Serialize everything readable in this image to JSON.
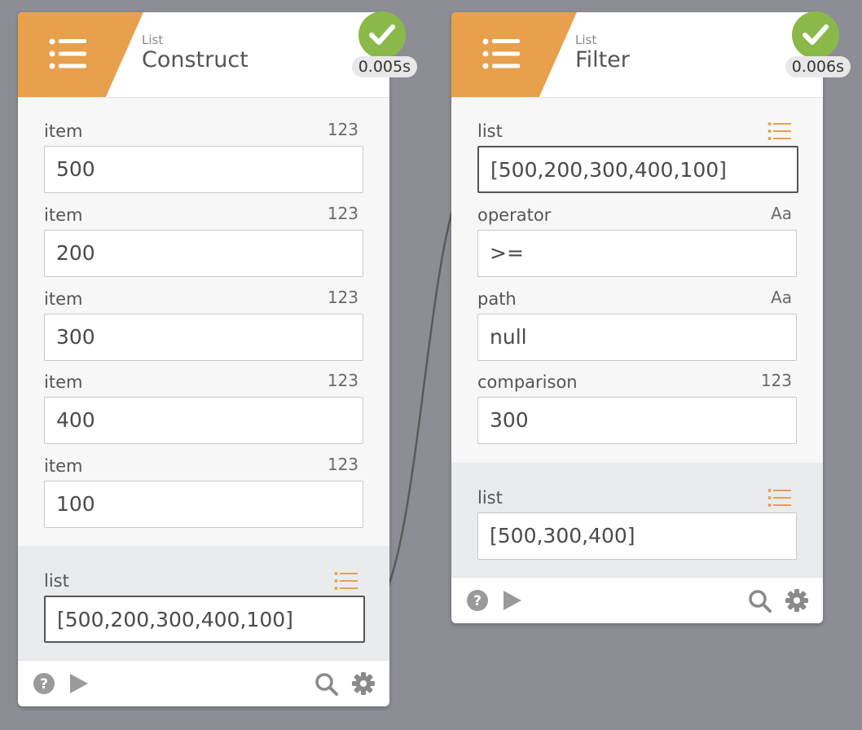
{
  "nodes": {
    "construct": {
      "category": "List",
      "title": "Construct",
      "timing": "0.005s",
      "inputs": [
        {
          "label": "item",
          "type": "123",
          "value": "500"
        },
        {
          "label": "item",
          "type": "123",
          "value": "200"
        },
        {
          "label": "item",
          "type": "123",
          "value": "300"
        },
        {
          "label": "item",
          "type": "123",
          "value": "400"
        },
        {
          "label": "item",
          "type": "123",
          "value": "100"
        }
      ],
      "output": {
        "label": "list",
        "type_icon": "list-icon",
        "value": "[500,200,300,400,100]"
      }
    },
    "filter": {
      "category": "List",
      "title": "Filter",
      "timing": "0.006s",
      "inputs": [
        {
          "label": "list",
          "type_icon": "list-icon",
          "value": "[500,200,300,400,100]"
        },
        {
          "label": "operator",
          "type": "Aa",
          "value": ">="
        },
        {
          "label": "path",
          "type": "Aa",
          "value": "null"
        },
        {
          "label": "comparison",
          "type": "123",
          "value": "300"
        }
      ],
      "output": {
        "label": "list",
        "type_icon": "list-icon",
        "value": "[500,300,400]"
      }
    }
  },
  "colors": {
    "accent": "#e8a04c",
    "success": "#8ab94a",
    "background": "#8d8e95"
  },
  "footer_icons": [
    "help-icon",
    "play-icon",
    "search-icon",
    "gear-icon"
  ]
}
